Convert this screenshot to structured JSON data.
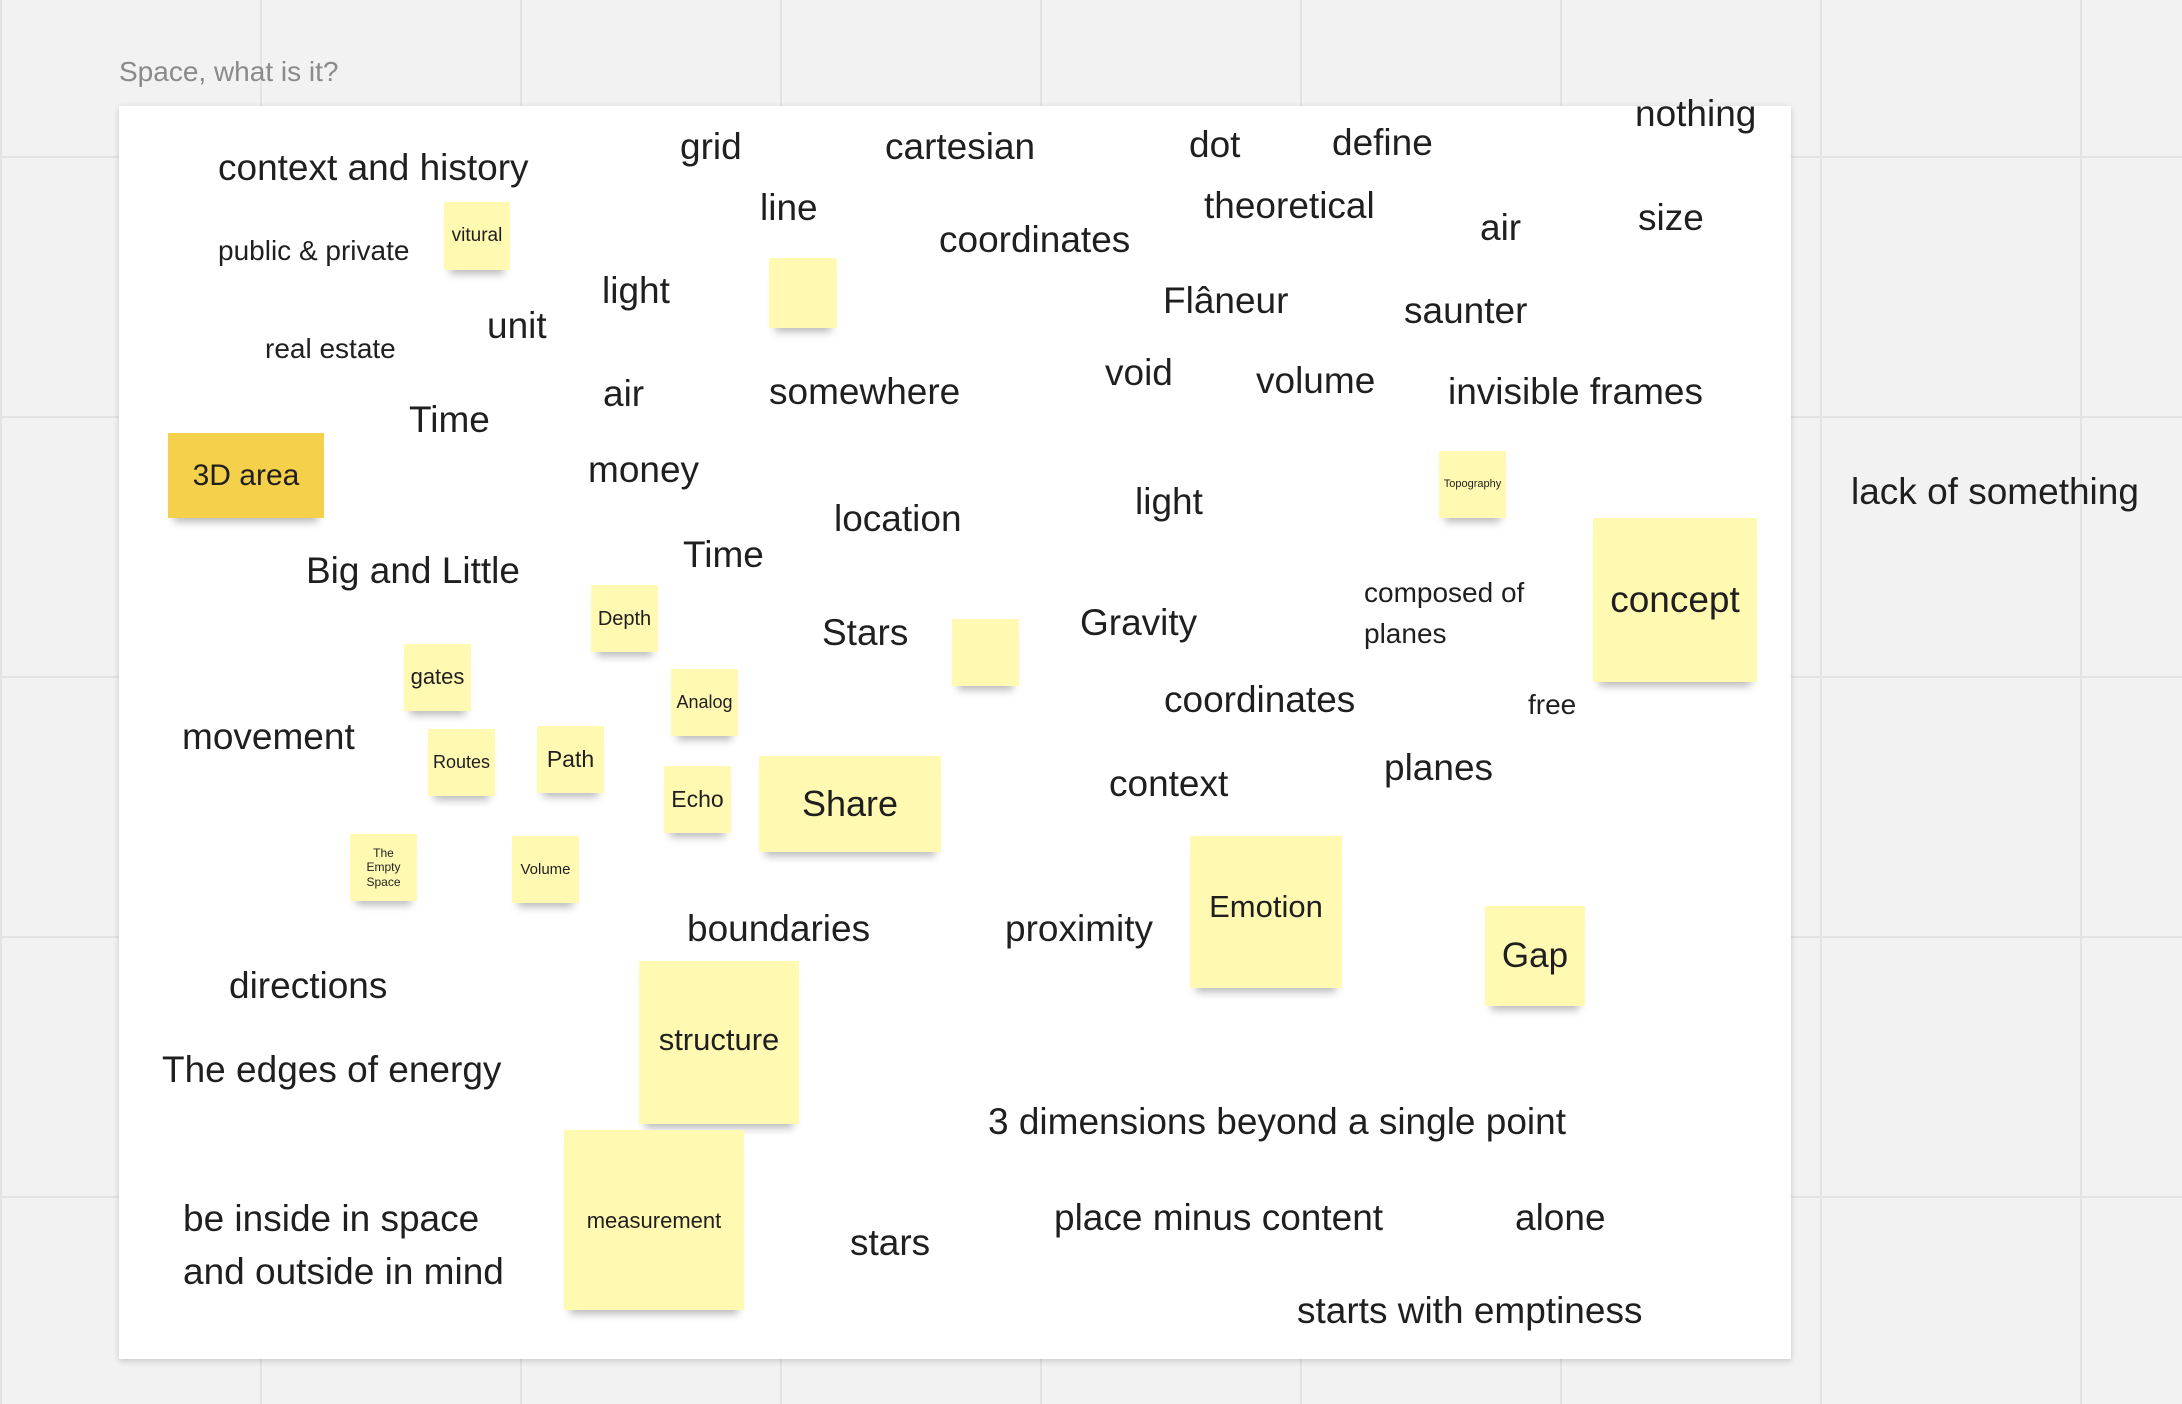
{
  "board": {
    "frame_title": "Space, what is it?",
    "outside_word": "lack of something"
  },
  "colors": {
    "canvas": "#f2f2f2",
    "grid_line": "#e3e3e3",
    "frame_bg": "#ffffff",
    "sticky_yellow": "#fff9b1",
    "sticky_orange": "#f5d04a",
    "text": "#1f1f1f",
    "frame_title": "#8a8a8a"
  },
  "words": [
    "context and history",
    "grid",
    "cartesian",
    "dot",
    "define",
    "nothing",
    "line",
    "theoretical",
    "public & private",
    "coordinates",
    "air",
    "size",
    "light",
    "Flâneur",
    "saunter",
    "unit",
    "real estate",
    "void",
    "volume",
    "air",
    "somewhere",
    "invisible frames",
    "Time",
    "money",
    "location",
    "light",
    "Big and Little",
    "Time",
    "composed of",
    "planes",
    "Stars",
    "Gravity",
    "movement",
    "coordinates",
    "free",
    "context",
    "planes",
    "boundaries",
    "proximity",
    "directions",
    "The edges of energy",
    "3 dimensions beyond a single point",
    "be inside in space",
    "and outside in mind",
    "stars",
    "place minus content",
    "alone",
    "starts with emptiness"
  ],
  "stickies": [
    "vitural",
    "",
    "3D area",
    "Topography",
    "concept",
    "Depth",
    "gates",
    "",
    "Analog",
    "Routes",
    "Path",
    "Echo",
    "Share",
    "The Empty Space",
    "Volume",
    "Emotion",
    "Gap",
    "structure",
    "measurement"
  ]
}
